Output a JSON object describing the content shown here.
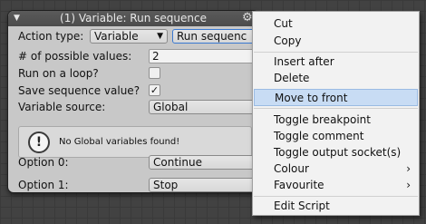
{
  "node": {
    "title": "(1) Variable: Run sequence",
    "action_type_label": "Action type:",
    "action_type_value": "Variable",
    "action_type_value2": "Run sequenc",
    "possible_values_label": "# of possible values:",
    "possible_values": "2",
    "run_loop_label": "Run on a loop?",
    "save_sequence_label": "Save sequence value?",
    "save_sequence_check": "✓",
    "variable_source_label": "Variable source:",
    "variable_source_value": "Global",
    "help_message": "No Global variables found!",
    "option0_label": "Option 0:",
    "option0_value": "Continue",
    "option1_label": "Option 1:",
    "option1_value": "Stop"
  },
  "context_menu": {
    "items": [
      {
        "label": "Cut"
      },
      {
        "label": "Copy"
      },
      {
        "label": "Insert after"
      },
      {
        "label": "Delete"
      },
      {
        "label": "Move to front"
      },
      {
        "label": "Toggle breakpoint"
      },
      {
        "label": "Toggle comment"
      },
      {
        "label": "Toggle output socket(s)"
      },
      {
        "label": "Colour",
        "submenu": "›"
      },
      {
        "label": "Favourite",
        "submenu": "›"
      },
      {
        "label": "Edit Script"
      }
    ]
  }
}
